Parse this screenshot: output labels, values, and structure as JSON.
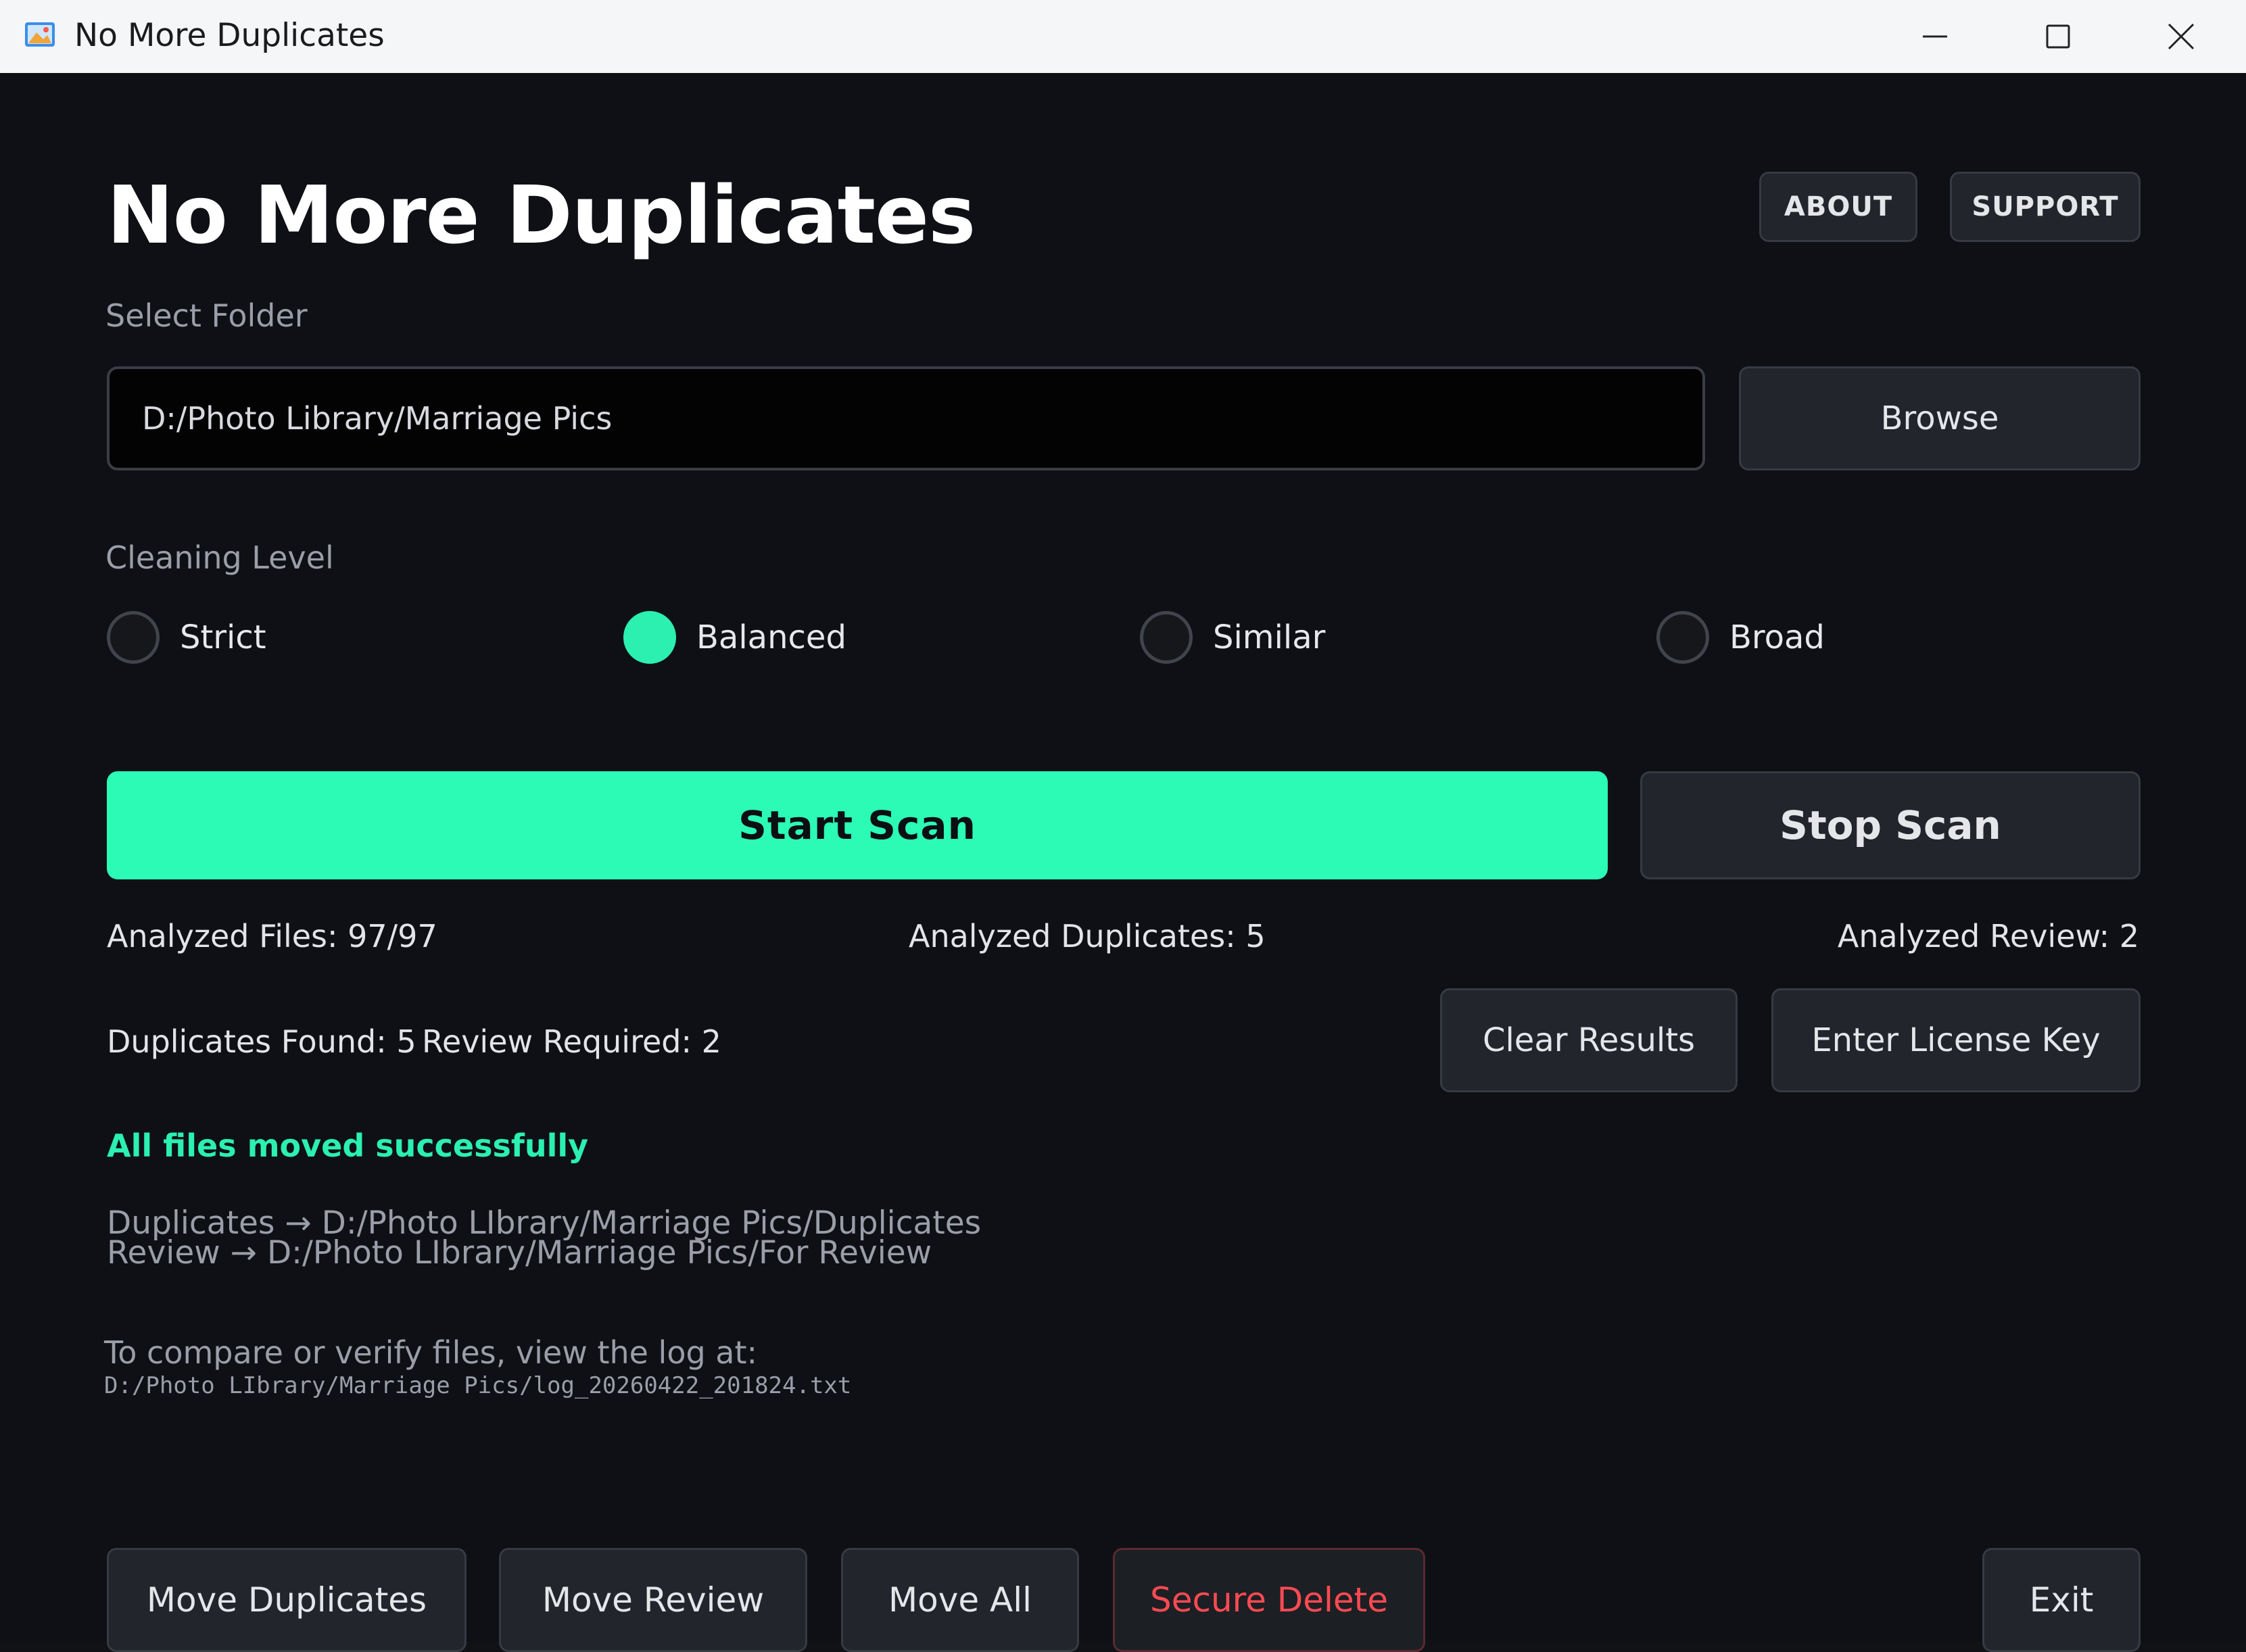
{
  "window": {
    "title": "No More Duplicates",
    "icon": "photo-app-icon"
  },
  "header": {
    "title": "No More Duplicates",
    "about_label": "ABOUT",
    "support_label": "SUPPORT"
  },
  "folder": {
    "label": "Select Folder",
    "path": "D:/Photo Library/Marriage Pics",
    "browse_label": "Browse"
  },
  "cleaning": {
    "label": "Cleaning Level",
    "options": [
      {
        "label": "Strict",
        "selected": false
      },
      {
        "label": "Balanced",
        "selected": true
      },
      {
        "label": "Similar",
        "selected": false
      },
      {
        "label": "Broad",
        "selected": false
      }
    ]
  },
  "scan": {
    "start_label": "Start Scan",
    "stop_label": "Stop Scan"
  },
  "stats": {
    "analyzed_files": "Analyzed Files: 97/97",
    "analyzed_duplicates": "Analyzed Duplicates: 5",
    "analyzed_review": "Analyzed Review: 2",
    "duplicates_found": "Duplicates Found: 5",
    "review_required": "Review Required: 2"
  },
  "actions": {
    "clear_results": "Clear Results",
    "enter_license": "Enter License Key"
  },
  "result": {
    "message": "All files moved successfully",
    "duplicates_path": "Duplicates → D:/Photo LIbrary/Marriage Pics/Duplicates",
    "review_path": "Review → D:/Photo LIbrary/Marriage Pics/For Review",
    "log_hint": "To compare or verify files, view the log at:",
    "log_path": "D:/Photo LIbrary/Marriage Pics/log_20260422_201824.txt"
  },
  "footer": {
    "move_duplicates": "Move Duplicates",
    "move_review": "Move Review",
    "move_all": "Move All",
    "secure_delete": "Secure Delete",
    "exit": "Exit"
  },
  "colors": {
    "accent": "#2bfbb5",
    "danger": "#ff4a52",
    "background": "#0e1015"
  }
}
